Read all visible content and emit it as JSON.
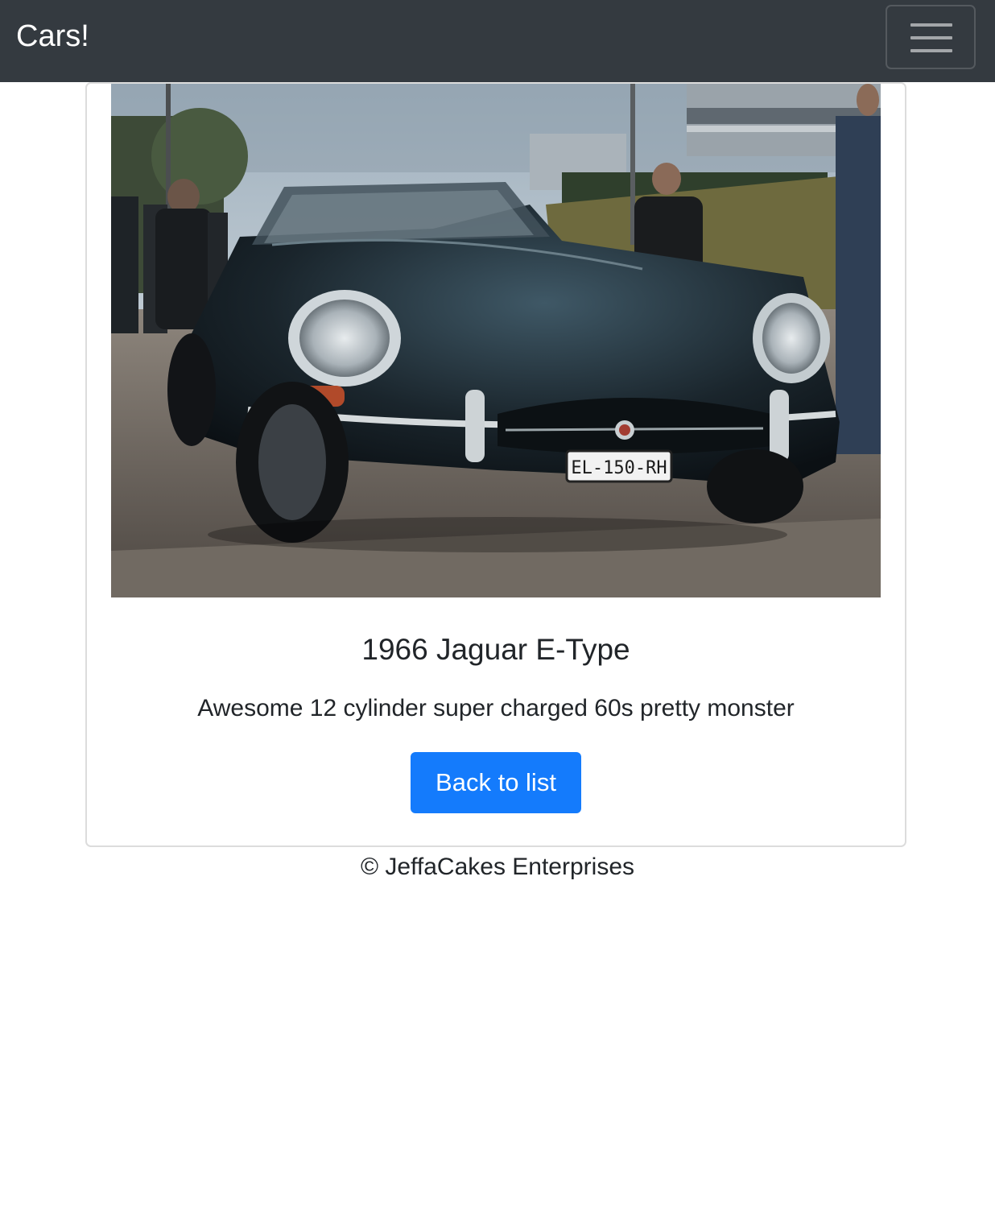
{
  "navbar": {
    "brand": "Cars!",
    "toggler_icon": "hamburger-menu-icon",
    "background_color": "#343a40"
  },
  "car": {
    "title": "1966 Jaguar E-Type",
    "description": "Awesome 12 cylinder super charged 60s pretty monster",
    "image_alt": "1966 Jaguar E-Type",
    "plate": "EL-150-RH",
    "back_button_label": "Back to list",
    "button_color": "#147bfc"
  },
  "footer": {
    "text": "© JeffaCakes Enterprises"
  }
}
